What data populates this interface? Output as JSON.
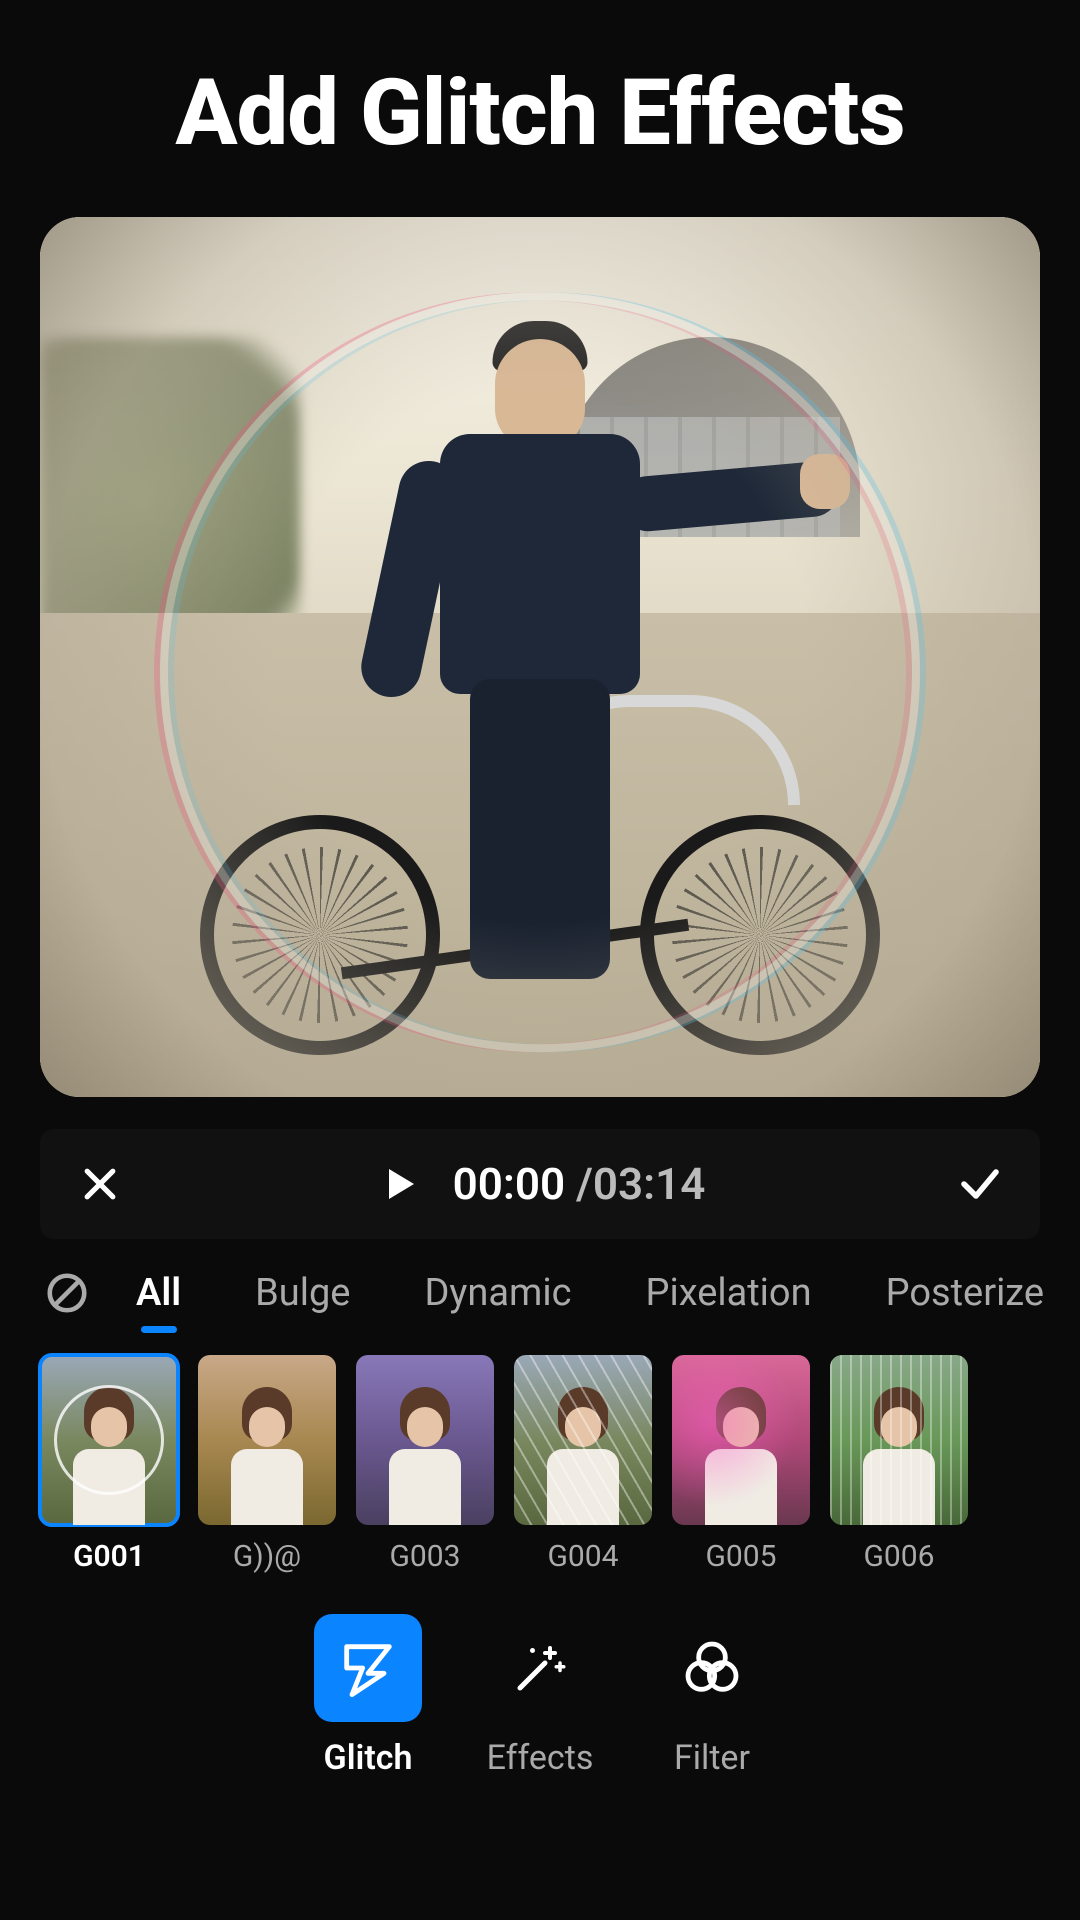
{
  "headline": "Add Glitch Effects",
  "playbar": {
    "current_time": "00:00",
    "separator": " /",
    "total_time": "03:14"
  },
  "categories": {
    "items": [
      {
        "label": "All",
        "active": true
      },
      {
        "label": "Bulge",
        "active": false
      },
      {
        "label": "Dynamic",
        "active": false
      },
      {
        "label": "Pixelation",
        "active": false
      },
      {
        "label": "Posterize",
        "active": false
      }
    ]
  },
  "effects": {
    "items": [
      {
        "label": "G001",
        "selected": true,
        "tint": "none"
      },
      {
        "label": "G))@",
        "selected": false,
        "tint": "warm"
      },
      {
        "label": "G003",
        "selected": false,
        "tint": "purple"
      },
      {
        "label": "G004",
        "selected": false,
        "tint": "streak"
      },
      {
        "label": "G005",
        "selected": false,
        "tint": "magenta"
      },
      {
        "label": "G006",
        "selected": false,
        "tint": "rain"
      }
    ]
  },
  "tools": {
    "items": [
      {
        "label": "Glitch",
        "icon": "glitch-icon",
        "active": true
      },
      {
        "label": "Effects",
        "icon": "sparkle-wand-icon",
        "active": false
      },
      {
        "label": "Filter",
        "icon": "overlap-circles-icon",
        "active": false
      }
    ]
  },
  "colors": {
    "accent": "#0a84ff"
  }
}
